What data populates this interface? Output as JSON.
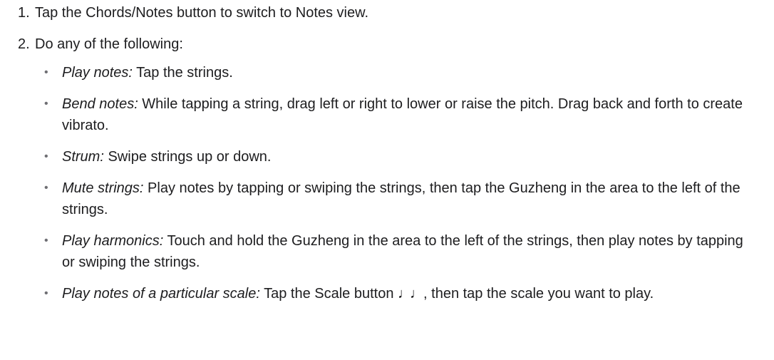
{
  "steps": [
    {
      "number": "1.",
      "text": "Tap the Chords/Notes button to switch to Notes view."
    },
    {
      "number": "2.",
      "text": "Do any of the following:"
    }
  ],
  "bullet_glyph": "•",
  "bullets": [
    {
      "term": "Play notes:",
      "text": " Tap the strings."
    },
    {
      "term": "Bend notes:",
      "text": " While tapping a string, drag left or right to lower or raise the pitch. Drag back and forth to create vibrato."
    },
    {
      "term": "Strum:",
      "text": " Swipe strings up or down."
    },
    {
      "term": "Mute strings:",
      "text": " Play notes by tapping or swiping the strings, then tap the Guzheng in the area to the left of the strings."
    },
    {
      "term": "Play harmonics:",
      "text": " Touch and hold the Guzheng in the area to the left of the strings, then play notes by tapping or swiping the strings."
    },
    {
      "term": "Play notes of a particular scale:",
      "text": " Tap the Scale button ",
      "icon": "♩♩",
      "text_after": ", then tap the scale you want to play."
    }
  ],
  "icons": {
    "scale_button_icon": "scale-icon"
  }
}
